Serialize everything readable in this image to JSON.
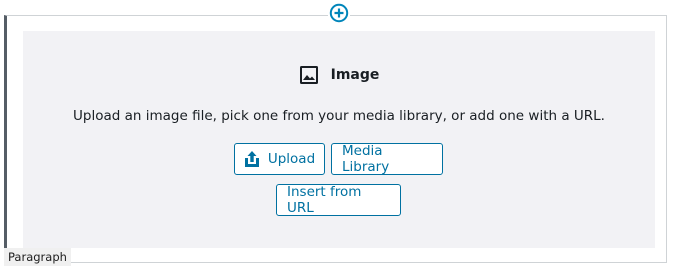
{
  "inserter": {
    "icon": "plus-circle-icon",
    "color": "#0085ba"
  },
  "placeholder": {
    "icon": "image-icon",
    "title": "Image",
    "instructions": "Upload an image file, pick one from your media library, or add one with a URL."
  },
  "buttons": {
    "upload_icon": "upload-icon",
    "upload_label": "Upload",
    "media_label": "Media Library",
    "url_label": "Insert from URL",
    "accent_color": "#0071a1"
  },
  "block_tag": {
    "label": "Paragraph"
  }
}
